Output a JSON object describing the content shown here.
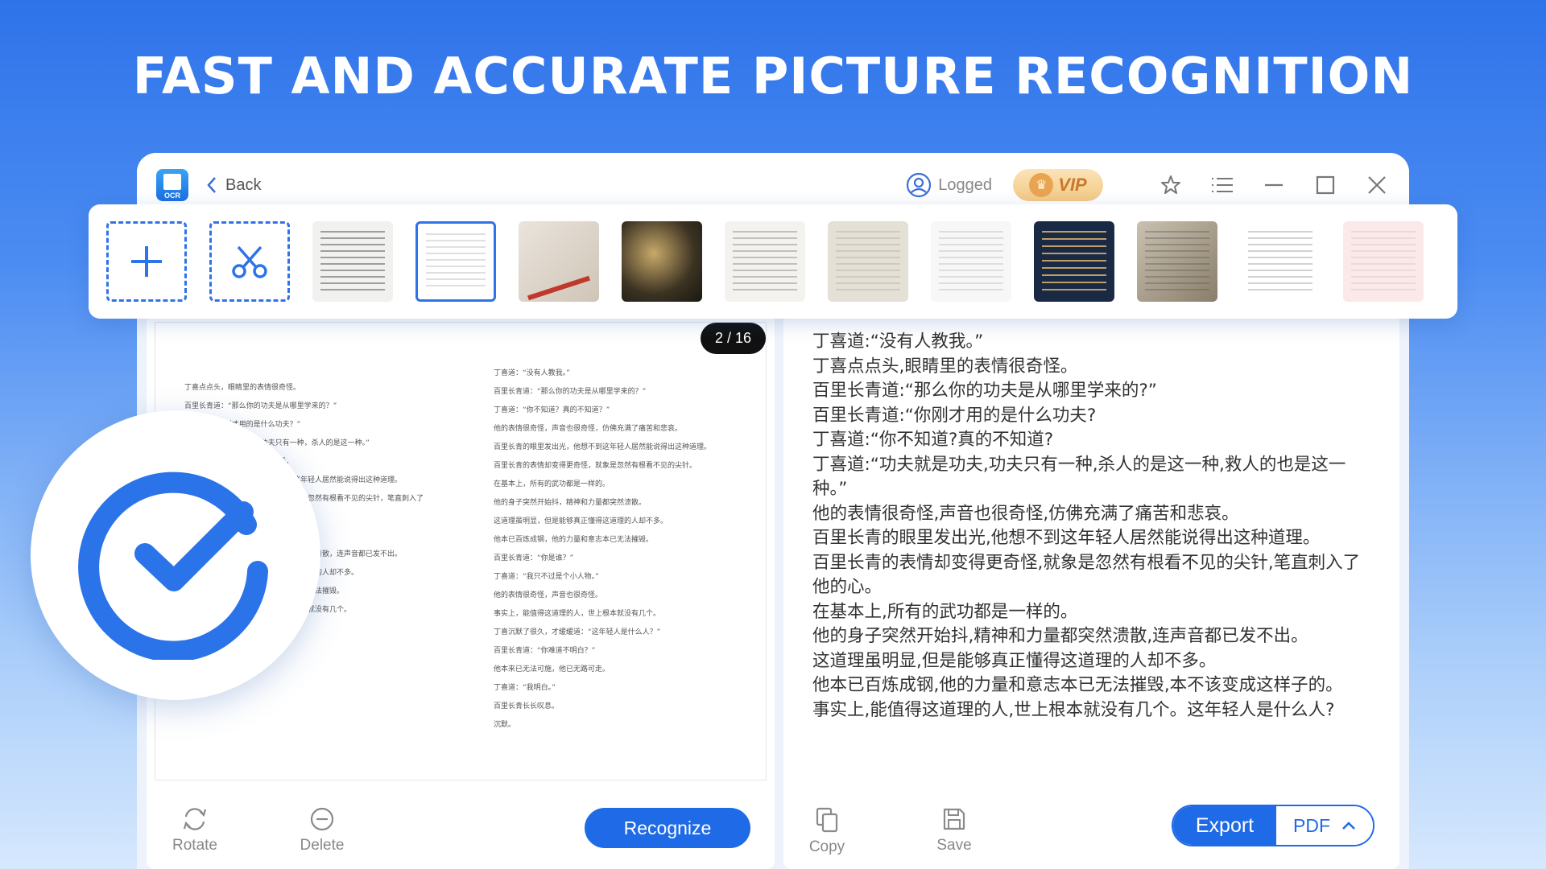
{
  "headline": "FAST AND ACCURATE PICTURE RECOGNITION",
  "titlebar": {
    "logo_label": "OCR",
    "back_label": "Back",
    "logged_label": "Logged",
    "vip_label": "VIP",
    "icons": [
      "star-icon",
      "menu-icon",
      "minimize-icon",
      "maximize-icon",
      "close-icon"
    ]
  },
  "thumbnails": {
    "add_icon": "plus-icon",
    "crop_icon": "scissors-icon",
    "selected_index": 1
  },
  "preview": {
    "page_counter": "2 / 16",
    "left_column": [
      "丁喜点点头，眼睛里的表情很奇怪。",
      "百里长青道：“那么你的功夫是从哪里学来的？”",
      "丁喜道：“你刚才用的是什么功夫？”",
      "丁喜：“功夫就是功夫，功夫只有一种，杀人的是这一种。”",
      "他的表情很奇怪，声音也很奇怪。",
      "百里长青的眼里发出光，他想不到这年轻人居然能说得出这种道理。",
      "百里长青的表情却变得更奇怪，就象是忽然有根看不见的尖针，笔直刺入了他的心。",
      "在基本上，所有的武功都是一样的。",
      "他的身子突然开始抖，精神和力量都突然溃散，连声音都已发不出。",
      "这道理虽明显，但是能够真正懂得这道理的人却不多。",
      "他本已百炼成钢，他的力量和意志本已无法摧毁。",
      "事实上，能值得这道理的人，世上根本就没有几个。",
      "这年轻人是什么人？"
    ],
    "right_column": [
      "丁喜道：“没有人教我。”",
      "百里长青道：“那么你的功夫是从哪里学来的？”",
      "丁喜道：“你不知道？真的不知道？”",
      "他的表情很奇怪，声音也很奇怪，仿佛充满了痛苦和悲哀。",
      "百里长青的眼里发出光，他想不到这年轻人居然能说得出这种道理。",
      "百里长青的表情却变得更奇怪，就象是忽然有根看不见的尖针。",
      "在基本上，所有的武功都是一样的。",
      "他的身子突然开始抖，精神和力量都突然溃散。",
      "这道理虽明显，但是能够真正懂得这道理的人却不多。",
      "他本已百炼成钢，他的力量和意志本已无法摧毁。",
      "百里长青道：“你是谁？”",
      "丁喜道：“我只不过是个小人物。”",
      "他的表情很奇怪，声音也很奇怪。",
      "事实上，能值得这道理的人，世上根本就没有几个。",
      "丁喜沉默了很久，才缓缓道：“这年轻人是什么人？”",
      "百里长青道：“你难道不明白？”",
      "他本来已无法可施，他已无路可走。",
      "丁喜道：“我明白。”",
      "百里长青长长叹息。",
      "沉默。"
    ]
  },
  "left_toolbar": {
    "rotate_label": "Rotate",
    "delete_label": "Delete",
    "recognize_label": "Recognize"
  },
  "ocr_result": [
    "丁喜道:“没有人教我。”",
    "丁喜点点头,眼睛里的表情很奇怪。",
    "百里长青道:“那么你的功夫是从哪里学来的?”",
    "百里长青道:“你刚才用的是什么功夫?",
    "丁喜道:“你不知道?真的不知道?",
    "丁喜道:“功夫就是功夫,功夫只有一种,杀人的是这一种,救人的也是这一种。”",
    "他的表情很奇怪,声音也很奇怪,仿佛充满了痛苦和悲哀。",
    "百里长青的眼里发出光,他想不到这年轻人居然能说得出这种道理。",
    "百里长青的表情却变得更奇怪,就象是忽然有根看不见的尖针,笔直刺入了他的心。",
    "在基本上,所有的武功都是一样的。",
    "他的身子突然开始抖,精神和力量都突然溃散,连声音都已发不出。",
    "这道理虽明显,但是能够真正懂得这道理的人却不多。",
    "他本已百炼成钢,他的力量和意志本已无法摧毁,本不该变成这样子的。",
    "事实上,能值得这道理的人,世上根本就没有几个。这年轻人是什么人?"
  ],
  "right_toolbar": {
    "copy_label": "Copy",
    "save_label": "Save",
    "export_label": "Export",
    "format_value": "PDF"
  },
  "colors": {
    "accent": "#1f6ae6",
    "background_top": "#2f73ea",
    "vip_gold": "#f3c983"
  }
}
